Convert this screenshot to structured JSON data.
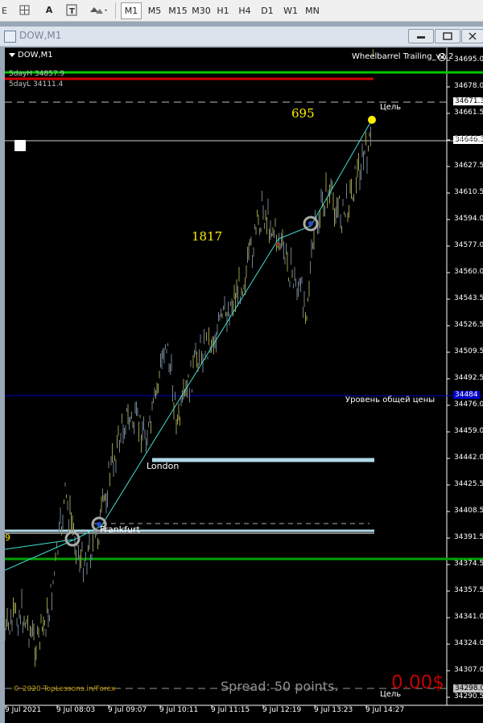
{
  "toolbar": {
    "drawing_tools": [
      "text-label-icon",
      "text-tool-icon",
      "shapes-dropdown-icon"
    ],
    "text_tool_label": "A",
    "timeframes": [
      "M1",
      "M5",
      "M15",
      "M30",
      "H1",
      "H4",
      "D1",
      "W1",
      "MN"
    ],
    "active_timeframe": "M1"
  },
  "window": {
    "title": "DOW,M1",
    "buttons": [
      "minimize",
      "restore",
      "close"
    ]
  },
  "chart": {
    "symbol_label": "DOW,M1",
    "indicator_label": "Wheelbarrel Trailing_v1.2",
    "day_high_label": "5dayH 34857.9",
    "day_low_label": "5dayL 34111.4",
    "count_top": "695",
    "count_mid": "1817",
    "target_label_top": "Цель",
    "target_label_bottom": "Цель",
    "general_level_label": "Уровень общей цены",
    "london_label": "London",
    "frankfurt_label": "Frankfurt",
    "left_partial_label": "9",
    "copyright": "© 2020 TopLessons.in/Forex",
    "spread_label": "Spread: 50 points.",
    "profit_label": "0.00$",
    "price_ticks": [
      "34695.0",
      "34678.0",
      "34661.5",
      "34644.5",
      "34627.5",
      "34610.5",
      "34594.0",
      "34577.0",
      "34560.0",
      "34543.5",
      "34526.5",
      "34509.5",
      "34492.5",
      "34476.0",
      "34459.0",
      "34442.0",
      "34425.5",
      "34408.5",
      "34391.5",
      "34374.5",
      "34357.5",
      "34341.0",
      "34324.0",
      "34307.0",
      "34290.5"
    ],
    "price_tags": {
      "upper_dashed": "34671.3",
      "current": "34646.3",
      "general_level": "34484",
      "lower_dashed": "34298.0"
    },
    "time_ticks": [
      "9 Jul 2021",
      "9 Jul 08:03",
      "9 Jul 09:07",
      "9 Jul 10:11",
      "9 Jul 11:15",
      "9 Jul 12:19",
      "9 Jul 13:23",
      "9 Jul 14:27"
    ],
    "colors": {
      "background": "#000000",
      "bars": "#708090",
      "highlight_bars": "#9a9a4a",
      "day_high": "#00c800",
      "day_low": "#d00000",
      "general_level": "#0000c8",
      "session_lines": "#b0d8e8",
      "trend_line": "#40e0d0",
      "level_green": "#00a000",
      "text_yellow": "#ffee00",
      "profit_red": "#c00000"
    }
  }
}
